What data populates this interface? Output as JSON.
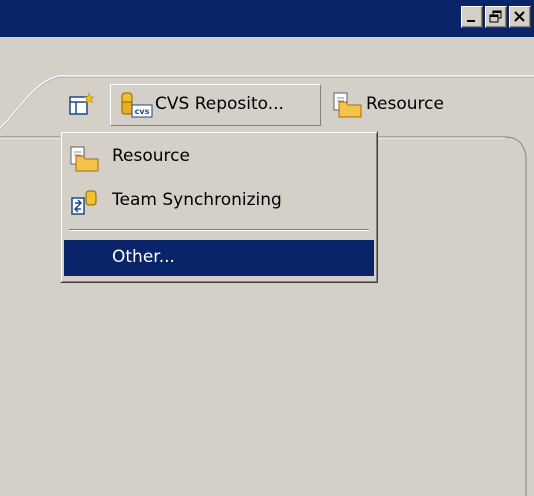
{
  "window": {
    "minimize_icon": "minimize-icon",
    "restore_icon": "restore-icon",
    "close_icon": "close-icon"
  },
  "toolbar": {
    "open_perspective_icon": "open-perspective-icon",
    "active_perspective": {
      "label": "CVS Reposito...",
      "icon": "cvs-repository-icon"
    },
    "other_perspective": {
      "label": "Resource",
      "icon": "resource-folder-icon"
    }
  },
  "menu": {
    "items": [
      {
        "label": "Resource",
        "icon": "resource-folder-icon"
      },
      {
        "label": "Team Synchronizing",
        "icon": "team-synchronizing-icon"
      },
      {
        "label": "Other...",
        "selected": true
      }
    ]
  },
  "colors": {
    "titlebar": "#0a246a",
    "selection": "#0a246a",
    "face": "#d4d0c8"
  }
}
